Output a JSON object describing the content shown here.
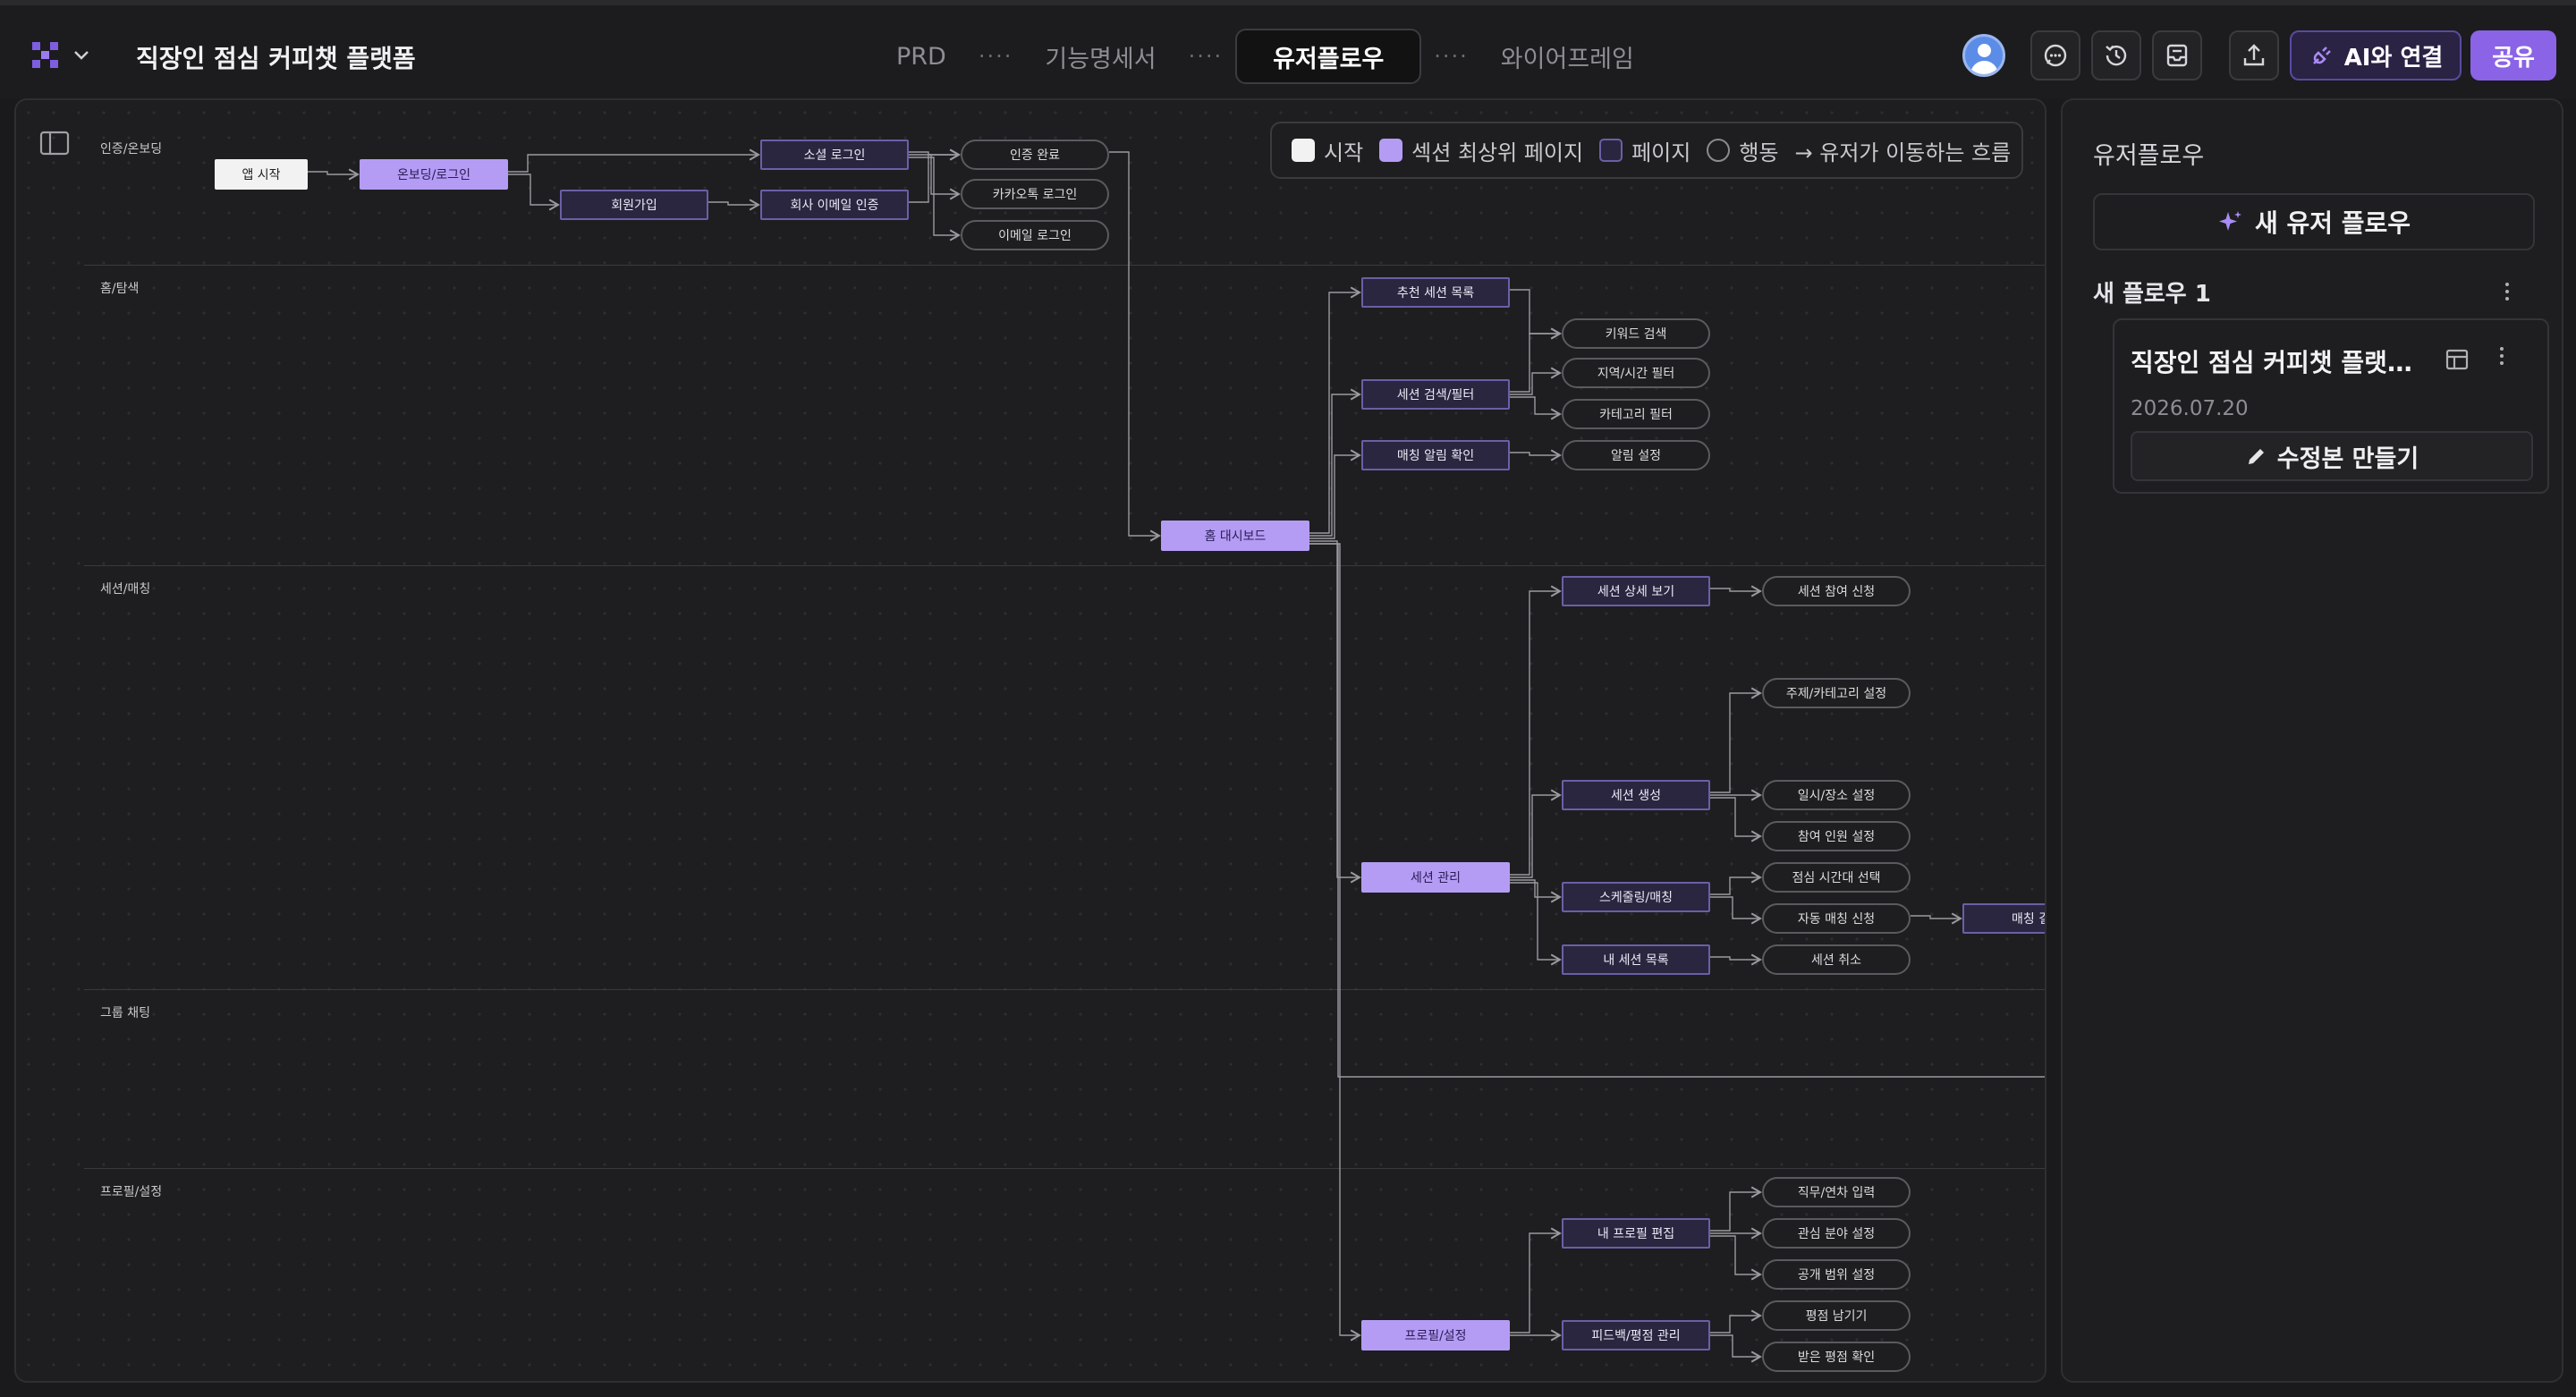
{
  "header": {
    "project_title": "직장인 점심 커피챗 플랫폼",
    "tabs": [
      {
        "label": "PRD"
      },
      {
        "label": "기능명세서"
      },
      {
        "label": "유저플로우"
      },
      {
        "label": "와이어프레임"
      }
    ],
    "tab_separator": "····",
    "ai_button_label": "AI와 연결",
    "share_button_label": "공유",
    "icons": [
      "logo-icon",
      "chevron-down-icon",
      "avatar",
      "comment-icon",
      "history-icon",
      "inbox-icon",
      "upload-icon",
      "plug-icon"
    ]
  },
  "legend": [
    {
      "label": "시작",
      "kind": "start"
    },
    {
      "label": "섹션 최상위 페이지",
      "kind": "top"
    },
    {
      "label": "페이지",
      "kind": "page"
    },
    {
      "label": "행동",
      "kind": "action"
    },
    {
      "label": "→ 유저가 이동하는 흐름",
      "kind": "arrow"
    }
  ],
  "lanes": [
    {
      "label": "인증/온보딩"
    },
    {
      "label": "홈/탐색"
    },
    {
      "label": "세션/매칭"
    },
    {
      "label": "그룹 채팅"
    },
    {
      "label": "프로필/설정"
    }
  ],
  "nodes": [
    {
      "label": "앱 시작",
      "kind": "start"
    },
    {
      "label": "온보딩/로그인",
      "kind": "top"
    },
    {
      "label": "소셜 로그인",
      "kind": "page"
    },
    {
      "label": "회원가입",
      "kind": "page"
    },
    {
      "label": "회사 이메일 인증",
      "kind": "page"
    },
    {
      "label": "인증 완료",
      "kind": "action"
    },
    {
      "label": "카카오톡 로그인",
      "kind": "action"
    },
    {
      "label": "이메일 로그인",
      "kind": "action"
    },
    {
      "label": "추천 세션 목록",
      "kind": "page"
    },
    {
      "label": "세션 검색/필터",
      "kind": "page"
    },
    {
      "label": "매칭 알림 확인",
      "kind": "page"
    },
    {
      "label": "키워드 검색",
      "kind": "action"
    },
    {
      "label": "지역/시간 필터",
      "kind": "action"
    },
    {
      "label": "카테고리 필터",
      "kind": "action"
    },
    {
      "label": "알림 설정",
      "kind": "action"
    },
    {
      "label": "홈 대시보드",
      "kind": "top"
    },
    {
      "label": "세션 상세 보기",
      "kind": "page"
    },
    {
      "label": "세션 참여 신청",
      "kind": "action"
    },
    {
      "label": "주제/카테고리 설정",
      "kind": "action"
    },
    {
      "label": "세션 생성",
      "kind": "page"
    },
    {
      "label": "일시/장소 설정",
      "kind": "action"
    },
    {
      "label": "참여 인원 설정",
      "kind": "action"
    },
    {
      "label": "세션 관리",
      "kind": "top"
    },
    {
      "label": "스케줄링/매칭",
      "kind": "page"
    },
    {
      "label": "점심 시간대 선택",
      "kind": "action"
    },
    {
      "label": "자동 매칭 신청",
      "kind": "action"
    },
    {
      "label": "매칭 결과",
      "kind": "page"
    },
    {
      "label": "내 세션 목록",
      "kind": "page"
    },
    {
      "label": "세션 취소",
      "kind": "action"
    },
    {
      "label": "내 프로필 편집",
      "kind": "page"
    },
    {
      "label": "직무/연차 입력",
      "kind": "action"
    },
    {
      "label": "관심 분야 설정",
      "kind": "action"
    },
    {
      "label": "공개 범위 설정",
      "kind": "action"
    },
    {
      "label": "프로필/설정",
      "kind": "top"
    },
    {
      "label": "피드백/평점 관리",
      "kind": "page"
    },
    {
      "label": "평점 남기기",
      "kind": "action"
    },
    {
      "label": "받은 평점 확인",
      "kind": "action"
    }
  ],
  "right_panel": {
    "title": "유저플로우",
    "new_flow_label": "새 유저 플로우",
    "group_label": "새 플로우 1",
    "card": {
      "title": "직장인 점심 커피챗 플랫폼 ...",
      "date": "2026.07.20",
      "revise_label": "수정본 만들기"
    }
  }
}
